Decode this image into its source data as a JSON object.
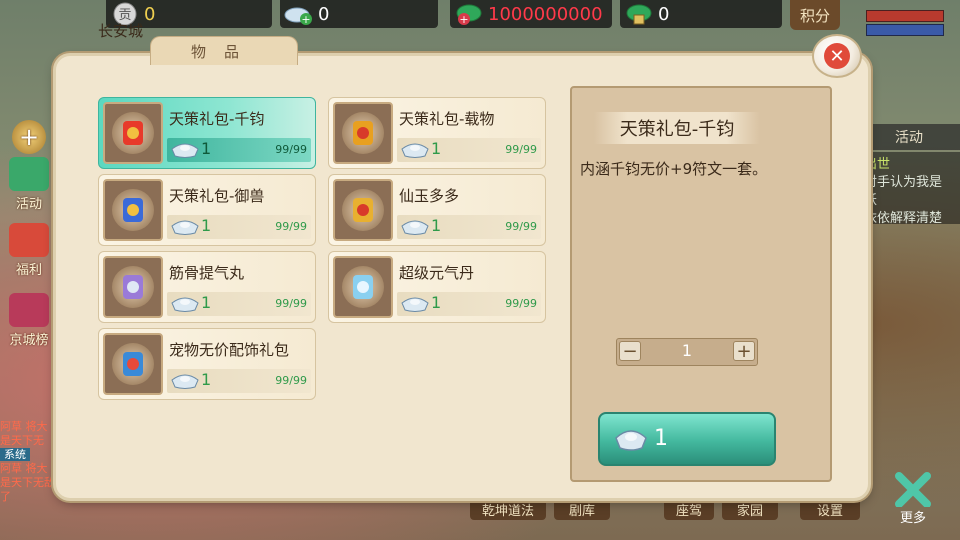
{
  "topbar": {
    "prestige": {
      "icon": "prestige-coin-icon",
      "value": "0"
    },
    "bound_ingot": {
      "icon": "ingot-add-icon",
      "value": "0"
    },
    "gold": {
      "icon": "gold-add-icon",
      "value": "1000000000",
      "color": "#ff3a4a"
    },
    "locked": {
      "icon": "lock-coin-icon",
      "value": "0"
    },
    "points_label": "积分",
    "city_label": "长安城"
  },
  "side_menu": [
    "活动",
    "福利",
    "京城榜"
  ],
  "chat": {
    "tag": "系统",
    "lines": [
      "阿草 将大",
      "是天下无",
      "阿草 将大",
      "是天下无敌了"
    ]
  },
  "activity": {
    "tab_label": "活动",
    "text_top": "出世",
    "text_lines": [
      "对手认为我是妖",
      "依依解释清楚"
    ]
  },
  "bottom_menu": [
    "乾坤道法",
    "剧库",
    "座驾",
    "家园",
    "设置"
  ],
  "more_label": "更多",
  "panel": {
    "tab_label": "物品",
    "close_icon": "close-icon",
    "items": [
      {
        "name": "天策礼包-千钧",
        "price": "1",
        "stock": "99/99",
        "icon": "gift-pack-red-icon",
        "selected": true
      },
      {
        "name": "天策礼包-载物",
        "price": "1",
        "stock": "99/99",
        "icon": "gift-pack-gold-icon",
        "selected": false
      },
      {
        "name": "天策礼包-御兽",
        "price": "1",
        "stock": "99/99",
        "icon": "gift-pack-blue-icon",
        "selected": false
      },
      {
        "name": "仙玉多多",
        "price": "1",
        "stock": "99/99",
        "icon": "jade-bag-icon",
        "selected": false
      },
      {
        "name": "筋骨提气丸",
        "price": "1",
        "stock": "99/99",
        "icon": "purple-pill-icon",
        "selected": false
      },
      {
        "name": "超级元气丹",
        "price": "1",
        "stock": "99/99",
        "icon": "crystal-orb-icon",
        "selected": false
      },
      {
        "name": "宠物无价配饰礼包",
        "price": "1",
        "stock": "99/99",
        "icon": "pet-gift-icon",
        "selected": false
      }
    ],
    "detail": {
      "title": "天策礼包-千钧",
      "description": "内涵千钧无价+9符文一套。",
      "quantity": "1",
      "minus_label": "−",
      "plus_label": "+",
      "buy_price": "1"
    }
  }
}
